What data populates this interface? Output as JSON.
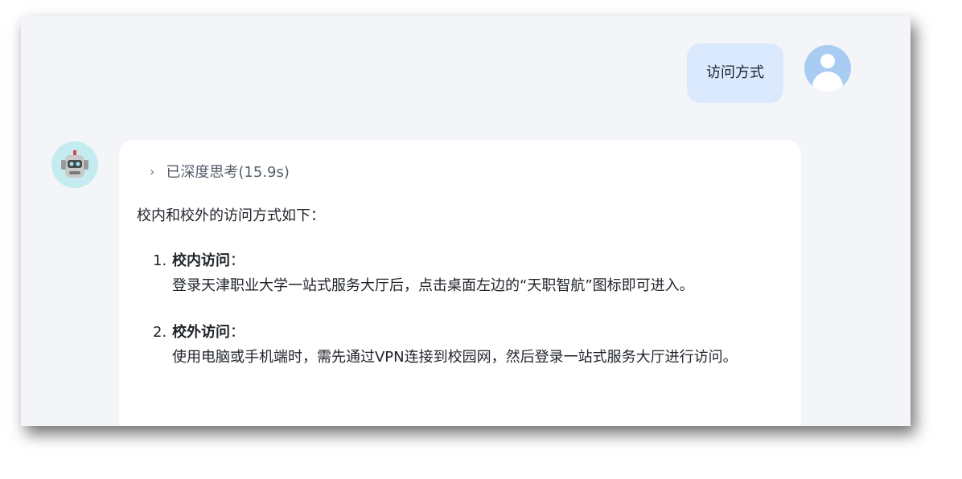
{
  "user_message": "访问方式",
  "thinking": {
    "label": "已深度思考(15.9s)"
  },
  "answer": {
    "intro": "校内和校外的访问方式如下：",
    "items": [
      {
        "number": "1.",
        "title": "校内访问",
        "colon": "：",
        "description": "登录天津职业大学一站式服务大厅后，点击桌面左边的“天职智航”图标即可进入。"
      },
      {
        "number": "2.",
        "title": "校外访问",
        "colon": "：",
        "description": "使用电脑或手机端时，需先通过VPN连接到校园网，然后登录一站式服务大厅进行访问。"
      }
    ]
  },
  "icons": {
    "user_avatar": "user-avatar-icon",
    "bot_avatar": "robot-avatar-icon",
    "chevron": "chevron-right-icon"
  },
  "colors": {
    "background": "#f3f5f9",
    "user_bubble": "#dbe9ff",
    "user_avatar": "#a9cdf2",
    "bot_avatar": "#c4ecf0",
    "card": "#ffffff"
  }
}
